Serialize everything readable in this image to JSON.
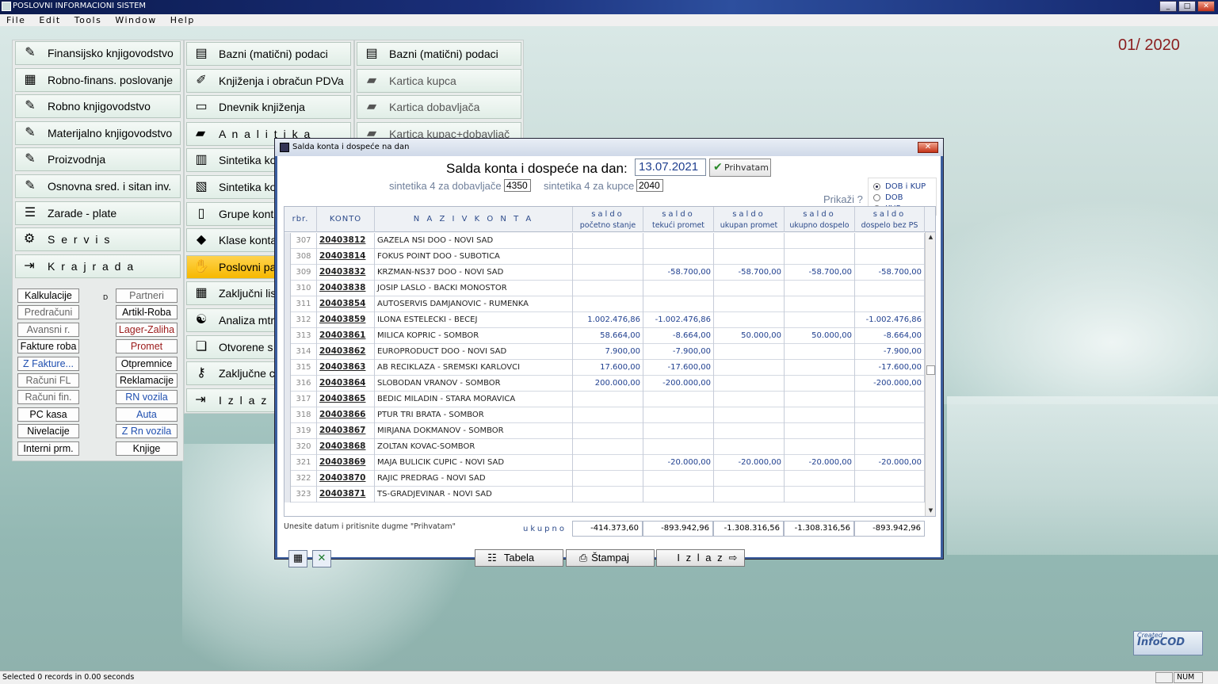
{
  "window": {
    "title": "POSLOVNI INFORMACIONI SISTEM",
    "min": "_",
    "max": "□",
    "close": "✕"
  },
  "menu": [
    "File",
    "Edit",
    "Tools",
    "Window",
    "Help"
  ],
  "period": "01/ 2020",
  "main_menu": [
    {
      "label": "Finansijsko knjigovodstvo",
      "icon": "ledger-icon",
      "glyph": "✎"
    },
    {
      "label": "Robno-finans. poslovanje",
      "icon": "cash-register-icon",
      "glyph": "▦"
    },
    {
      "label": "Robno knjigovodstvo",
      "icon": "ledger-icon",
      "glyph": "✎"
    },
    {
      "label": "Materijalno knjigovodstvo",
      "icon": "ledger-icon",
      "glyph": "✎"
    },
    {
      "label": "Proizvodnja",
      "icon": "ledger-icon",
      "glyph": "✎"
    },
    {
      "label": "Osnovna sred. i sitan inv.",
      "icon": "ledger-icon",
      "glyph": "✎"
    },
    {
      "label": "Zarade - plate",
      "icon": "payroll-icon",
      "glyph": "☰"
    },
    {
      "label": "S e r v i s",
      "icon": "service-icon",
      "glyph": "⚙"
    },
    {
      "label": "K r a j   r a d a",
      "icon": "exit-door-icon",
      "glyph": "⇥"
    }
  ],
  "small_buttons_left": [
    "Kalkulacije",
    "Predračuni",
    "Avansni r.",
    "Fakture roba",
    "Z Fakture...",
    "Računi FL",
    "Računi fin.",
    "PC kasa",
    "Nivelacije",
    "Interni prm."
  ],
  "small_buttons_right": [
    "Partneri",
    "Artikl-Roba",
    "Lager-Zaliha",
    "Promet",
    "Otpremnice",
    "Reklamacije",
    "RN vozila",
    "Auta",
    "Z Rn vozila",
    "Knjige"
  ],
  "small_marker": "D",
  "sub_menu_1": [
    {
      "label": "Bazni (matični) podaci",
      "icon": "database-icon",
      "glyph": "▤"
    },
    {
      "label": "Knjiženja i obračun PDVa",
      "icon": "booking-icon",
      "glyph": "✐"
    },
    {
      "label": "Dnevnik knjiženja",
      "icon": "journal-icon",
      "glyph": "▭"
    },
    {
      "label": "A n a l i t i k a",
      "icon": "analytics-icon",
      "glyph": "▰"
    },
    {
      "label": "Sintetika ko",
      "icon": "books-icon",
      "glyph": "▥"
    },
    {
      "label": "Sintetika ko",
      "icon": "books-stack-icon",
      "glyph": "▧"
    },
    {
      "label": "Grupe kont",
      "icon": "book-icon",
      "glyph": "▯"
    },
    {
      "label": "Klase konta",
      "icon": "red-book-icon",
      "glyph": "◆"
    },
    {
      "label": "Poslovni pa",
      "icon": "handshake-icon",
      "glyph": "✋"
    },
    {
      "label": "Zaključni lis",
      "icon": "calculator-icon",
      "glyph": "▦"
    },
    {
      "label": "Analiza mtr",
      "icon": "analysis-icon",
      "glyph": "☯"
    },
    {
      "label": "Otvorene s",
      "icon": "open-book-icon",
      "glyph": "❏"
    },
    {
      "label": "Zaključne c",
      "icon": "keys-icon",
      "glyph": "⚷"
    },
    {
      "label": "I z l a z",
      "icon": "exit-door-icon",
      "glyph": "⇥"
    }
  ],
  "sub_menu_2": [
    {
      "label": "Bazni (matični) podaci",
      "icon": "database-icon",
      "glyph": "▤"
    },
    {
      "label": "Kartica kupca",
      "icon": "card-icon",
      "glyph": "▰"
    },
    {
      "label": "Kartica dobavljača",
      "icon": "card-icon",
      "glyph": "▰"
    },
    {
      "label": "Kartica kupac+dobavljač",
      "icon": "card-icon",
      "glyph": "▰"
    }
  ],
  "dialog": {
    "title": "Salda konta i dospeće na dan",
    "close": "✕",
    "heading": "Salda konta i dospeće na dan:",
    "date": "13.07.2021",
    "accept": "Prihvatam",
    "sint_dob_label": "sintetika 4 za dobavljače",
    "sint_dob_value": "4350",
    "sint_kup_label": "sintetika 4 za kupce",
    "sint_kup_value": "2040",
    "prikazi": "Prikaži ?",
    "radios": [
      {
        "label": "DOB i KUP",
        "checked": true
      },
      {
        "label": "DOB",
        "checked": false
      },
      {
        "label": "KUP",
        "checked": false
      }
    ],
    "columns": {
      "rbr": "rbr.",
      "konto": "KONTO",
      "naziv": "N A Z I V   K O N T A",
      "saldo": "saldo",
      "c1": "početno stanje",
      "c2": "tekući promet",
      "c3": "ukupan promet",
      "c4": "ukupno dospelo",
      "c5": "dospelo bez PS"
    },
    "rows": [
      [
        "307",
        "20403812",
        "GAZELA NSI DOO - NOVI SAD",
        "",
        "",
        "",
        "",
        ""
      ],
      [
        "308",
        "20403814",
        "FOKUS POINT DOO - SUBOTICA",
        "",
        "",
        "",
        "",
        ""
      ],
      [
        "309",
        "20403832",
        "KRZMAN-NS37 DOO - NOVI SAD",
        "",
        "-58.700,00",
        "-58.700,00",
        "-58.700,00",
        "-58.700,00"
      ],
      [
        "310",
        "20403838",
        "JOSIP LASLO - BACKI MONOSTOR",
        "",
        "",
        "",
        "",
        ""
      ],
      [
        "311",
        "20403854",
        "AUTOSERVIS DAMJANOVIC - RUMENKA",
        "",
        "",
        "",
        "",
        ""
      ],
      [
        "312",
        "20403859",
        "ILONA ESTELECKI - BECEJ",
        "1.002.476,86",
        "-1.002.476,86",
        "",
        "",
        "-1.002.476,86"
      ],
      [
        "313",
        "20403861",
        "MILICA KOPRIC - SOMBOR",
        "58.664,00",
        "-8.664,00",
        "50.000,00",
        "50.000,00",
        "-8.664,00"
      ],
      [
        "314",
        "20403862",
        "EUROPRODUCT DOO - NOVI SAD",
        "7.900,00",
        "-7.900,00",
        "",
        "",
        "-7.900,00"
      ],
      [
        "315",
        "20403863",
        "AB RECIKLAZA - SREMSKI KARLOVCI",
        "17.600,00",
        "-17.600,00",
        "",
        "",
        "-17.600,00"
      ],
      [
        "316",
        "20403864",
        "SLOBODAN VRANOV - SOMBOR",
        "200.000,00",
        "-200.000,00",
        "",
        "",
        "-200.000,00"
      ],
      [
        "317",
        "20403865",
        "BEDIC MILADIN - STARA MORAVICA",
        "",
        "",
        "",
        "",
        ""
      ],
      [
        "318",
        "20403866",
        "PTUR TRI BRATA - SOMBOR",
        "",
        "",
        "",
        "",
        ""
      ],
      [
        "319",
        "20403867",
        "MIRJANA DOKMANOV - SOMBOR",
        "",
        "",
        "",
        "",
        ""
      ],
      [
        "320",
        "20403868",
        "ZOLTAN KOVAC-SOMBOR",
        "",
        "",
        "",
        "",
        ""
      ],
      [
        "321",
        "20403869",
        "MAJA BULICIK CUPIC - NOVI SAD",
        "",
        "-20.000,00",
        "-20.000,00",
        "-20.000,00",
        "-20.000,00"
      ],
      [
        "322",
        "20403870",
        "RAJIC PREDRAG - NOVI SAD",
        "",
        "",
        "",
        "",
        ""
      ],
      [
        "323",
        "20403871",
        "TS-GRADJEVINAR - NOVI SAD",
        "",
        "",
        "",
        "",
        ""
      ]
    ],
    "hint": "Unesite datum i pritisnite dugme \"Prihvatam\"",
    "ukupno": "ukupno",
    "totals": [
      "-414.373,60",
      "-893.942,96",
      "-1.308.316,56",
      "-1.308.316,56",
      "-893.942,96"
    ],
    "buttons": {
      "tabela": "Tabela",
      "stampaj": "Štampaj",
      "izlaz": "I z l a z"
    }
  },
  "logo": {
    "line1": "Created",
    "line2": "InfoCOD"
  },
  "statusbar": {
    "text": "Selected 0 records in 0.00 seconds",
    "num": "NUM"
  }
}
